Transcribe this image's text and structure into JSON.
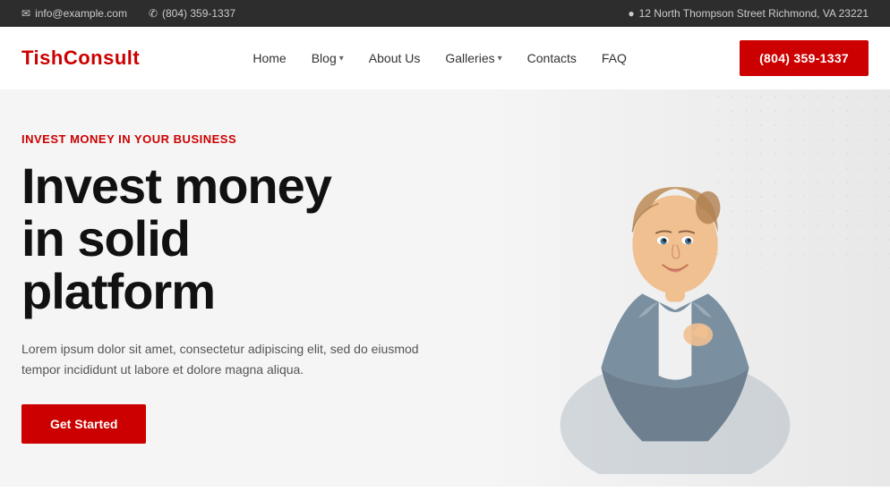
{
  "topbar": {
    "email": "info@example.com",
    "phone": "(804) 359-1337",
    "address": "12 North Thompson Street Richmond, VA 23221",
    "email_icon": "✉",
    "phone_icon": "✆",
    "address_icon": "✦"
  },
  "header": {
    "logo": "TishConsult",
    "nav": [
      {
        "label": "Home",
        "has_dropdown": false
      },
      {
        "label": "Blog",
        "has_dropdown": true
      },
      {
        "label": "About Us",
        "has_dropdown": false
      },
      {
        "label": "Galleries",
        "has_dropdown": true
      },
      {
        "label": "Contacts",
        "has_dropdown": false
      },
      {
        "label": "FAQ",
        "has_dropdown": false
      }
    ],
    "cta_phone": "(804) 359-1337"
  },
  "hero": {
    "tagline": "Invest Money In Your Business",
    "title_line1": "Invest money",
    "title_line2": "in solid",
    "title_line3": "platform",
    "description": "Lorem ipsum dolor sit amet, consectetur adipiscing elit, sed do eiusmod tempor incididunt ut labore et dolore magna aliqua.",
    "cta_label": "Get Started"
  }
}
